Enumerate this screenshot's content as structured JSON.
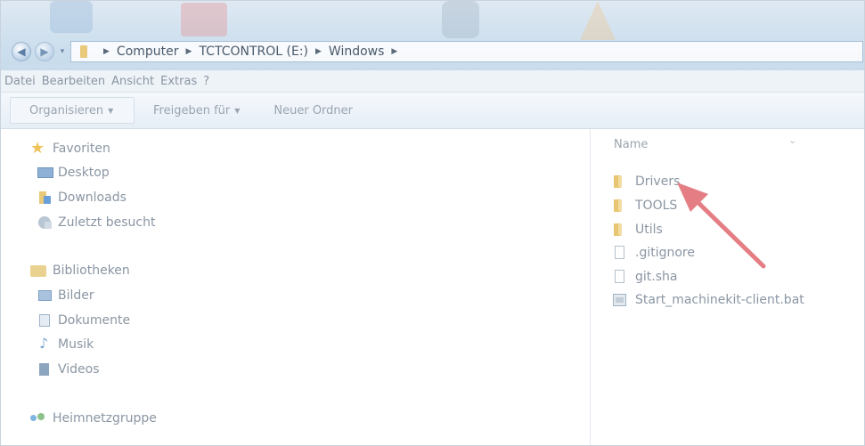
{
  "address_bar": {
    "crumbs": [
      "Computer",
      "TCTCONTROL (E:)",
      "Windows"
    ]
  },
  "menu": {
    "items": [
      "Datei",
      "Bearbeiten",
      "Ansicht",
      "Extras",
      "?"
    ]
  },
  "toolbar": {
    "organize_label": "Organisieren",
    "share_label": "Freigeben für",
    "new_folder_label": "Neuer Ordner"
  },
  "navigation": {
    "favorites": {
      "label": "Favoriten",
      "items": [
        "Desktop",
        "Downloads",
        "Zuletzt besucht"
      ]
    },
    "libraries": {
      "label": "Bibliotheken",
      "items": [
        "Bilder",
        "Dokumente",
        "Musik",
        "Videos"
      ]
    },
    "homegroup": {
      "label": "Heimnetzgruppe"
    }
  },
  "file_list": {
    "column_header": "Name",
    "files": [
      {
        "name": "Drivers",
        "type": "folder"
      },
      {
        "name": "TOOLS",
        "type": "folder"
      },
      {
        "name": "Utils",
        "type": "folder"
      },
      {
        "name": ".gitignore",
        "type": "file"
      },
      {
        "name": "git.sha",
        "type": "file"
      },
      {
        "name": "Start_machinekit-client.bat",
        "type": "batch-file"
      }
    ]
  },
  "annotation": {
    "color": "#e57e84",
    "target": "Drivers"
  },
  "colors": {
    "text_faded": "#8a96a3",
    "title_gradient": "#cfe0ee"
  }
}
